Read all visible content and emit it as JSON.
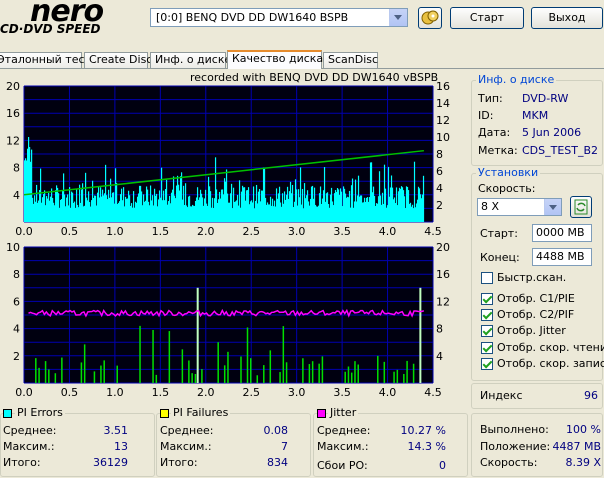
{
  "app": {
    "logo_top": "nero",
    "logo_bottom": "CD·DVD SPEED",
    "drive": "[0:0]  BENQ DVD DD DW1640 BSPB",
    "start_label": "Старт",
    "exit_label": "Выход"
  },
  "tabs": [
    {
      "label": "Эталонный тест"
    },
    {
      "label": "Create Disc"
    },
    {
      "label": "Инф. о диске"
    },
    {
      "label": "Качество диска",
      "active": true
    },
    {
      "label": "ScanDisc"
    }
  ],
  "recorded_with": "recorded with BENQ     DVD DD DW1640     vBSPB",
  "chart_data": [
    {
      "type": "bar",
      "name": "PI Errors / read speed",
      "x_ticks": [
        "0.0",
        "0.5",
        "1.0",
        "1.5",
        "2.0",
        "2.5",
        "3.0",
        "3.5",
        "4.0",
        "4.5"
      ],
      "xlim": [
        0,
        4.5
      ],
      "y_left_ticks": [
        "20",
        "16",
        "12",
        "8",
        "4"
      ],
      "y_left_lim": [
        0,
        20
      ],
      "y_right_ticks": [
        "16",
        "14",
        "12",
        "10",
        "8",
        "6",
        "4",
        "2"
      ],
      "y_right_lim": [
        0,
        16
      ],
      "bars_color": "#00ffff",
      "line_color": "#00c000",
      "line": {
        "x": [
          0.0,
          4.4
        ],
        "y": [
          3.2,
          8.39
        ]
      },
      "pi_errors_avg": 3.51,
      "pi_errors_max": 13
    },
    {
      "type": "bar",
      "name": "PI Failures / jitter",
      "x_ticks": [
        "0.0",
        "0.5",
        "1.0",
        "1.5",
        "2.0",
        "2.5",
        "3.0",
        "3.5",
        "4.0",
        "4.5"
      ],
      "xlim": [
        0,
        4.5
      ],
      "y_left_ticks": [
        "10",
        "8",
        "6",
        "4",
        "2"
      ],
      "y_left_lim": [
        0,
        10
      ],
      "y_right_ticks": [
        "20",
        "16",
        "12",
        "8",
        "4"
      ],
      "y_right_lim": [
        0,
        20
      ],
      "bars_color": "#00e000",
      "line_color": "#ff00ff",
      "jitter_avg": 10.27,
      "pif_max": 7
    }
  ],
  "disc_info": {
    "title": "Инф. о диске",
    "rows": [
      {
        "label": "Тип:",
        "value": "DVD-RW"
      },
      {
        "label": "ID:",
        "value": "MKM"
      },
      {
        "label": "Дата:",
        "value": "5 Jun 2006"
      },
      {
        "label": "Метка:",
        "value": "CDS_TEST_B2"
      }
    ]
  },
  "settings": {
    "title": "Установки",
    "speed_label": "Скорость:",
    "speed_value": "8 X",
    "start_label": "Старт:",
    "start_value": "0000 MB",
    "end_label": "Конец:",
    "end_value": "4488 MB",
    "checks": [
      {
        "label": "Быстр.скан.",
        "checked": false
      },
      {
        "label": "Отобр. C1/PIE",
        "checked": true
      },
      {
        "label": "Отобр. C2/PIF",
        "checked": true
      },
      {
        "label": "Отобр. Jitter",
        "checked": true
      },
      {
        "label": "Отобр. скор. чтения",
        "checked": true
      },
      {
        "label": "Отобр. скор. записи",
        "checked": true
      }
    ]
  },
  "index": {
    "label": "Индекс",
    "value": "96"
  },
  "progress": {
    "rows": [
      {
        "label": "Выполнено:",
        "value": "100 %"
      },
      {
        "label": "Положение:",
        "value": "4487 MB"
      },
      {
        "label": "Скорость:",
        "value": "8.39 X"
      }
    ]
  },
  "stats": {
    "pie": {
      "title": "PI Errors",
      "color": "#00ffff",
      "rows": [
        {
          "label": "Среднее:",
          "value": "3.51"
        },
        {
          "label": "Максим.:",
          "value": "13"
        },
        {
          "label": "Итого:",
          "value": "36129"
        }
      ]
    },
    "pif": {
      "title": "PI Failures",
      "color": "#ffff00",
      "rows": [
        {
          "label": "Среднее:",
          "value": "0.08"
        },
        {
          "label": "Максим.:",
          "value": "7"
        },
        {
          "label": "Итого:",
          "value": "834"
        }
      ]
    },
    "jitter": {
      "title": "Jitter",
      "color": "#ff00ff",
      "rows": [
        {
          "label": "Среднее:",
          "value": "10.27 %"
        },
        {
          "label": "Максим.:",
          "value": "14.3 %"
        }
      ]
    },
    "po": {
      "label": "Сбои PO:",
      "value": "0"
    }
  }
}
